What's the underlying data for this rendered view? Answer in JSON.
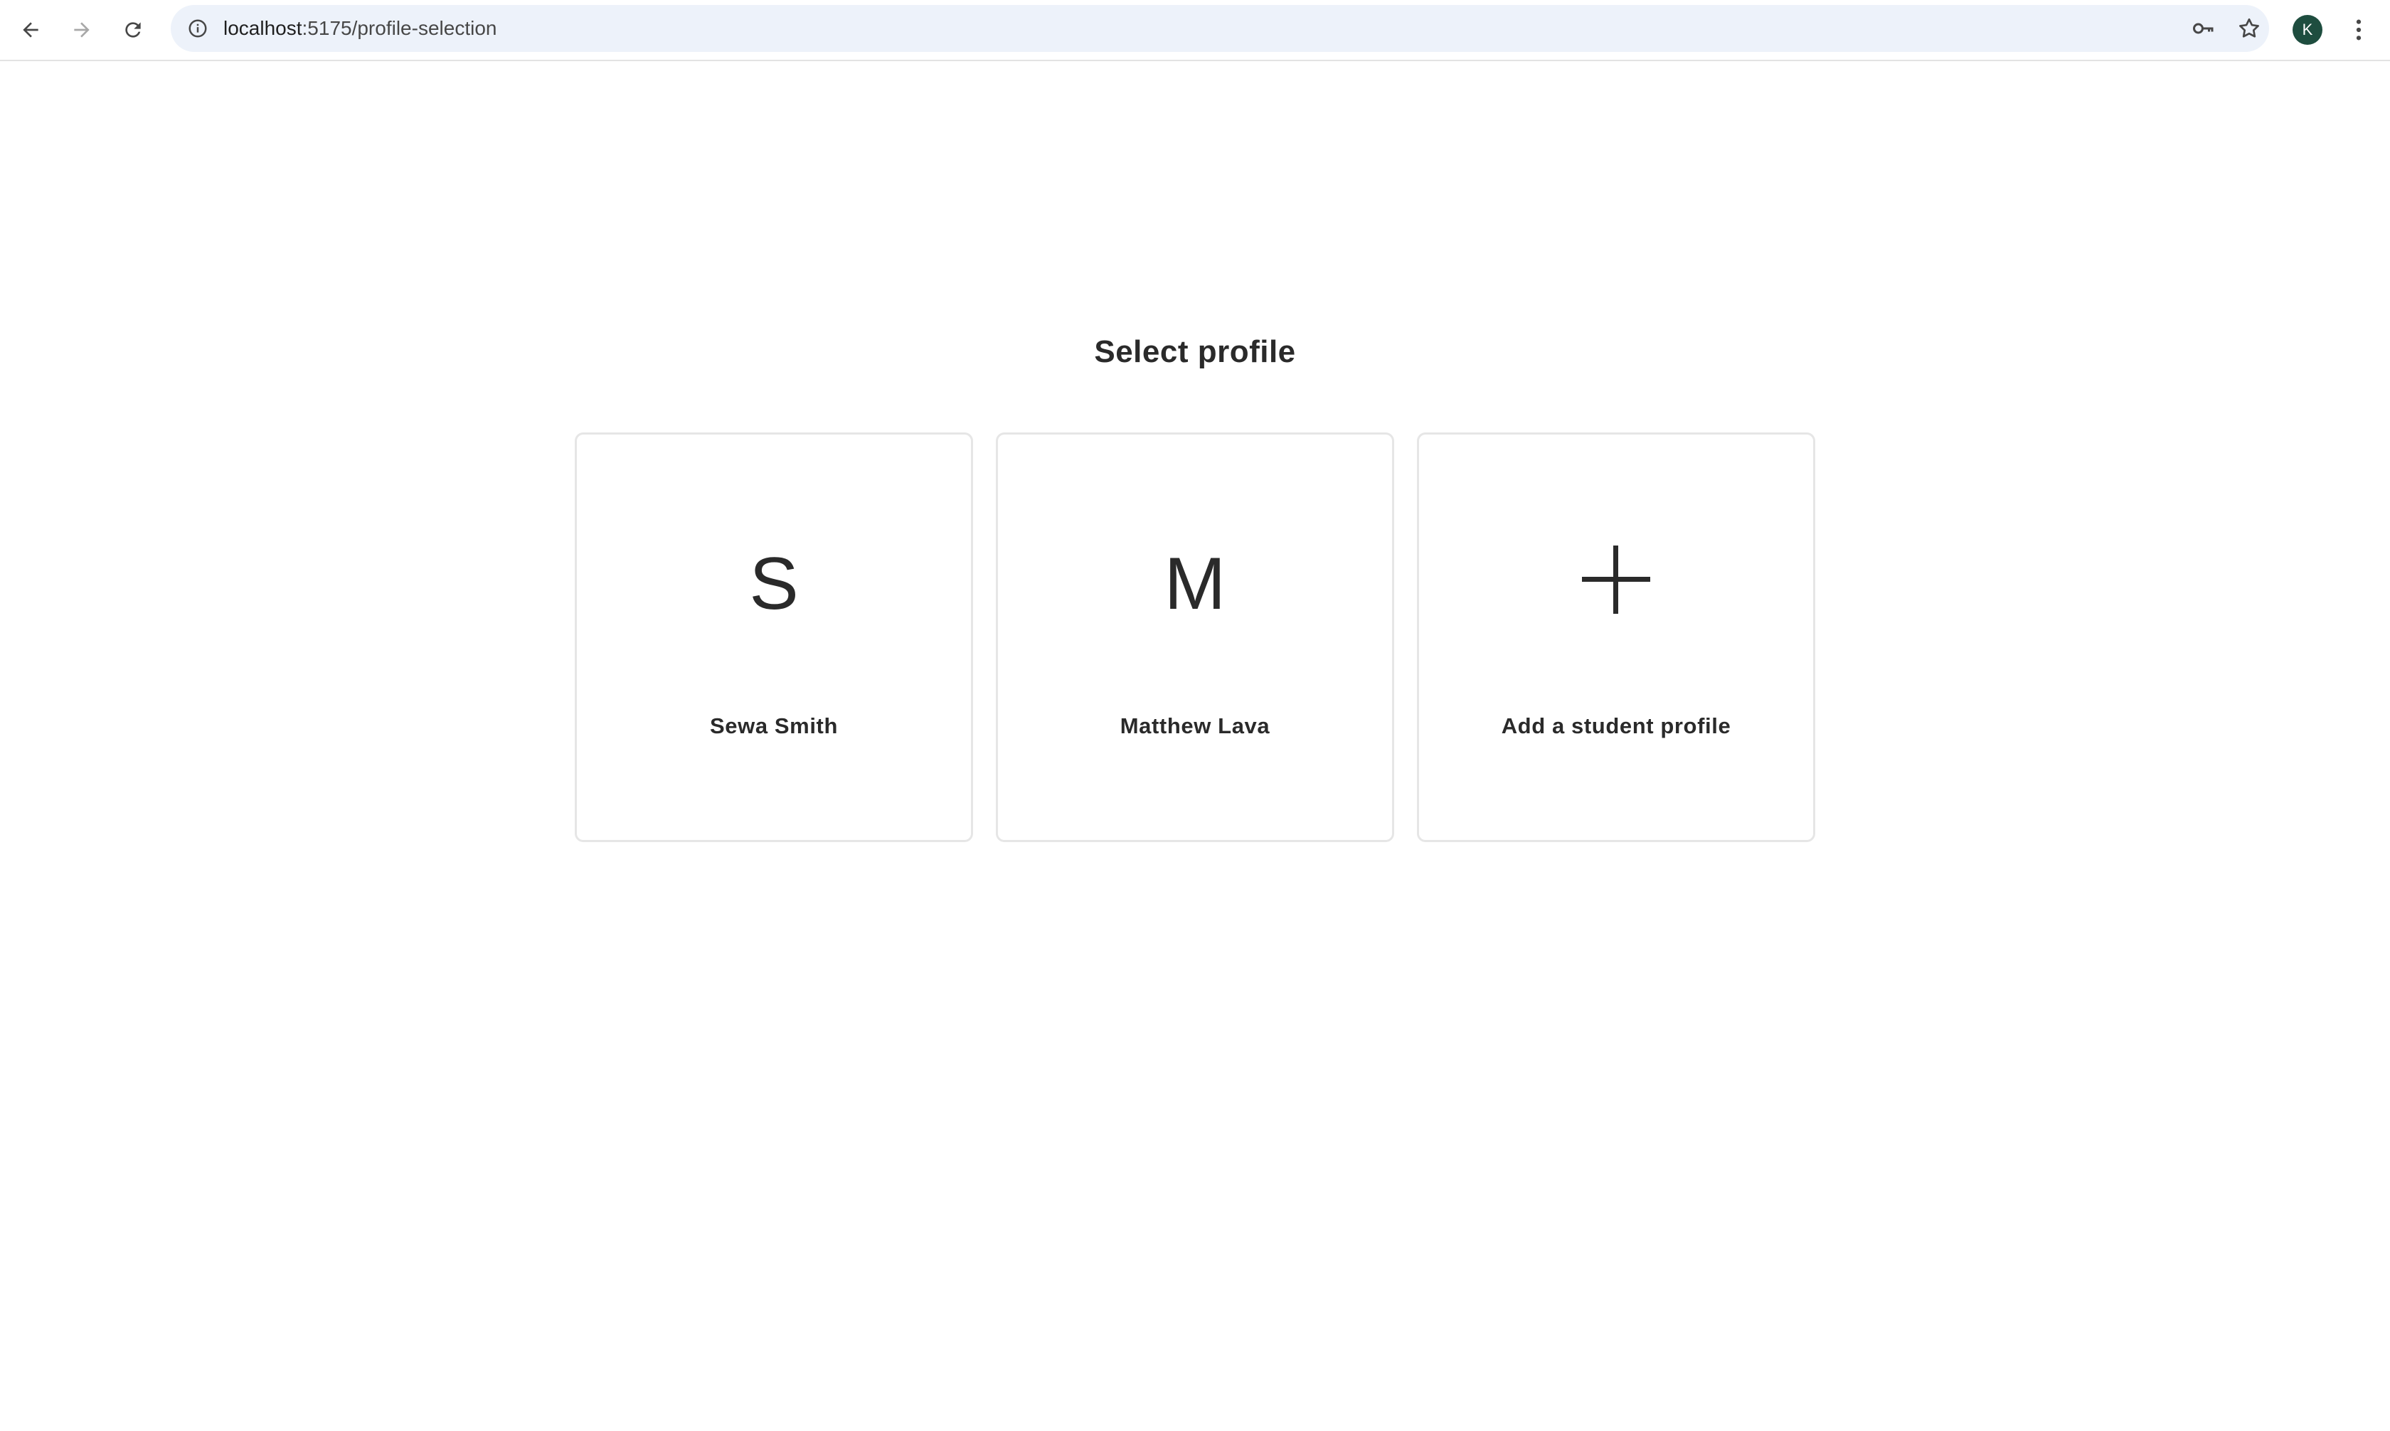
{
  "browser": {
    "url_host": "localhost",
    "url_path": ":5175/profile-selection",
    "icons": {
      "back": "arrow-left-icon",
      "forward": "arrow-right-icon",
      "reload": "reload-icon",
      "site_info": "info-circle-icon",
      "password": "key-icon",
      "bookmark": "star-icon",
      "menu": "kebab-menu-icon"
    },
    "profile_avatar": {
      "initial": "K",
      "color": "#1e4d3f"
    },
    "omnibox_color": "#edf2fa"
  },
  "page": {
    "title": "Select profile",
    "profiles": [
      {
        "initial": "S",
        "name": "Sewa Smith"
      },
      {
        "initial": "M",
        "name": "Matthew Lava"
      }
    ],
    "add_profile": {
      "icon": "plus-icon",
      "label": "Add a student profile"
    }
  }
}
